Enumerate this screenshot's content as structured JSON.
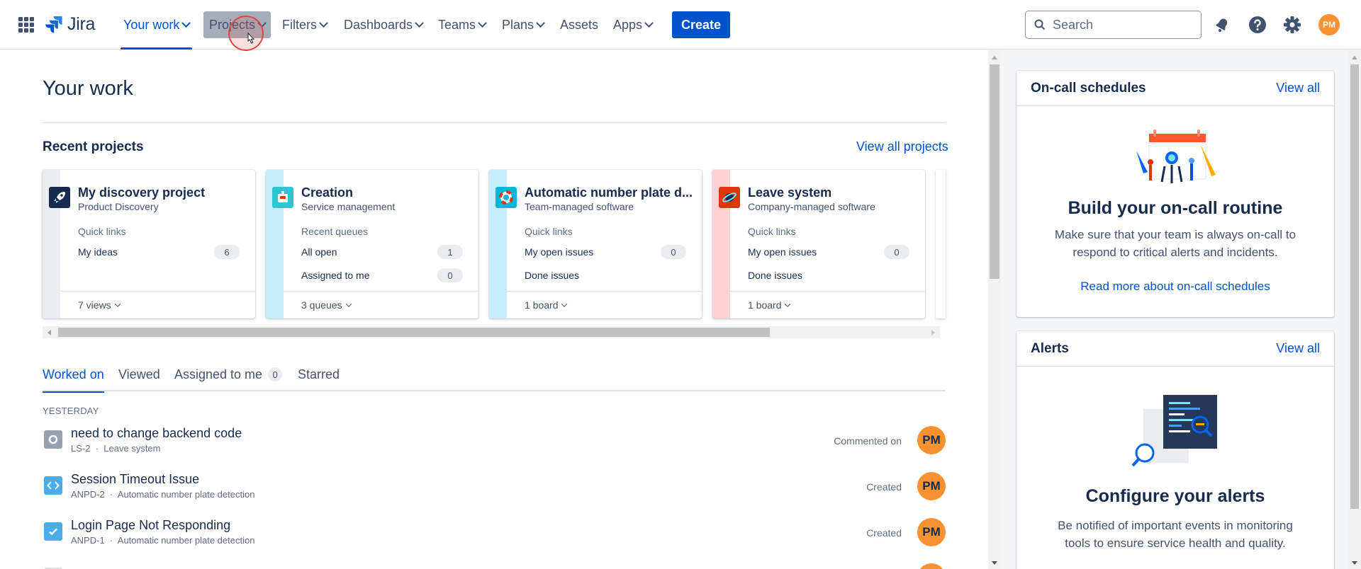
{
  "app": {
    "logo_text": "Jira"
  },
  "nav": {
    "items": [
      {
        "label": "Your work",
        "has_dropdown": true,
        "active": true
      },
      {
        "label": "Projects",
        "has_dropdown": true,
        "hovered": true
      },
      {
        "label": "Filters",
        "has_dropdown": true
      },
      {
        "label": "Dashboards",
        "has_dropdown": true
      },
      {
        "label": "Teams",
        "has_dropdown": true
      },
      {
        "label": "Plans",
        "has_dropdown": true
      },
      {
        "label": "Assets",
        "has_dropdown": false
      },
      {
        "label": "Apps",
        "has_dropdown": true
      }
    ],
    "create_label": "Create",
    "search_placeholder": "Search",
    "icons": [
      "notifications-icon",
      "help-icon",
      "settings-icon"
    ],
    "avatar_initials": "PM"
  },
  "main": {
    "title": "Your work",
    "recent_projects": {
      "title": "Recent projects",
      "view_all": "View all projects",
      "cards": [
        {
          "name": "My discovery project",
          "type": "Product Discovery",
          "section": "Quick links",
          "rows": [
            {
              "label": "My ideas",
              "count": "6"
            }
          ],
          "footer": "7 views",
          "stripe": "#ebecf0",
          "icon_bg": "#172b4d",
          "icon": "rocket-icon"
        },
        {
          "name": "Creation",
          "type": "Service management",
          "section": "Recent queues",
          "rows": [
            {
              "label": "All open",
              "count": "1"
            },
            {
              "label": "Assigned to me",
              "count": "0"
            }
          ],
          "footer": "3 queues",
          "stripe": "#c6edfb",
          "icon_bg": "#2ec5d3",
          "icon": "robot-icon"
        },
        {
          "name": "Automatic number plate d...",
          "type": "Team-managed software",
          "section": "Quick links",
          "rows": [
            {
              "label": "My open issues",
              "count": "0"
            },
            {
              "label": "Done issues",
              "count": ""
            }
          ],
          "footer": "1 board",
          "stripe": "#c6edfb",
          "icon_bg": "#00b8d9",
          "icon": "lifebuoy-icon"
        },
        {
          "name": "Leave system",
          "type": "Company-managed software",
          "section": "Quick links",
          "rows": [
            {
              "label": "My open issues",
              "count": "0"
            },
            {
              "label": "Done issues",
              "count": ""
            }
          ],
          "footer": "1 board",
          "stripe": "#ffd1d1",
          "icon_bg": "#de350b",
          "icon": "planet-icon"
        }
      ]
    },
    "tabs": [
      {
        "label": "Worked on",
        "active": true
      },
      {
        "label": "Viewed"
      },
      {
        "label": "Assigned to me",
        "badge": "0"
      },
      {
        "label": "Starred"
      }
    ],
    "day_label": "YESTERDAY",
    "items": [
      {
        "title": "need to change backend code",
        "key": "LS-2",
        "project": "Leave system",
        "action": "Commented on",
        "avatar": "PM",
        "type_icon": "task-gray-icon",
        "icon_color": "#97a0af"
      },
      {
        "title": "Session Timeout Issue",
        "key": "ANPD-2",
        "project": "Automatic number plate detection",
        "action": "Created",
        "avatar": "PM",
        "type_icon": "code-icon",
        "icon_color": "#4bade8"
      },
      {
        "title": "Login Page Not Responding",
        "key": "ANPD-1",
        "project": "Automatic number plate detection",
        "action": "Created",
        "avatar": "PM",
        "type_icon": "checkbox-icon",
        "icon_color": "#4bade8"
      }
    ],
    "separator": "·"
  },
  "right": {
    "oncall": {
      "title": "On-call schedules",
      "view_all": "View all",
      "heading": "Build your on-call routine",
      "text": "Make sure that your team is always on-call to respond to critical alerts and incidents.",
      "link": "Read more about on-call schedules"
    },
    "alerts": {
      "title": "Alerts",
      "view_all": "View all",
      "heading": "Configure your alerts",
      "text": "Be notified of important events in monitoring tools to ensure service health and quality."
    }
  },
  "colors": {
    "brand": "#0052cc",
    "avatar": "#f79232",
    "text": "#172b4d",
    "subtle": "#42526e"
  }
}
